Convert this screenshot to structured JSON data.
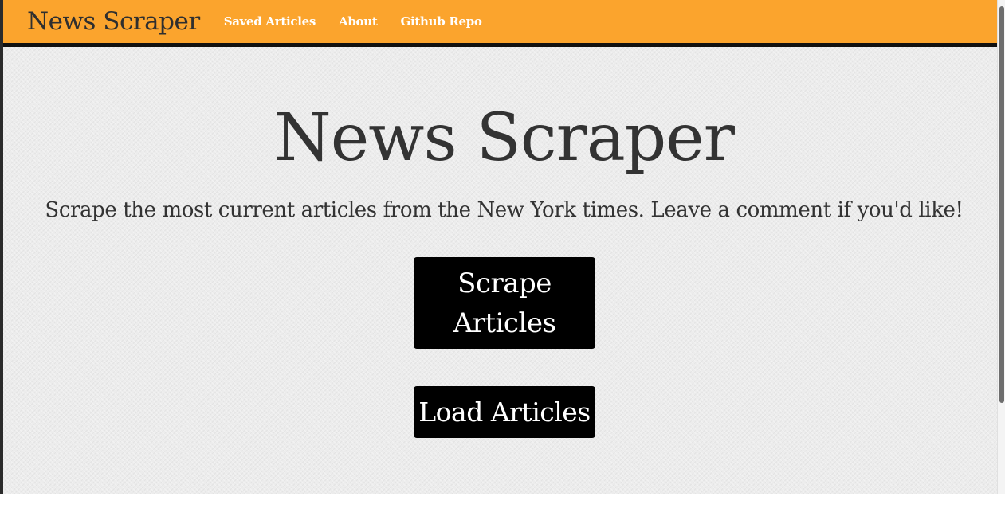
{
  "navbar": {
    "brand": "News Scraper",
    "links": [
      {
        "label": "Saved Articles"
      },
      {
        "label": "About"
      },
      {
        "label": "Github Repo"
      }
    ]
  },
  "hero": {
    "title": "News Scraper",
    "subtitle": "Scrape the most current articles from the New York times. Leave a comment if you'd like!"
  },
  "buttons": {
    "scrape_label": "Scrape Articles",
    "load_label": "Load Articles"
  },
  "colors": {
    "navbar_bg": "#fba42d",
    "button_bg": "#000000",
    "text": "#333333"
  }
}
